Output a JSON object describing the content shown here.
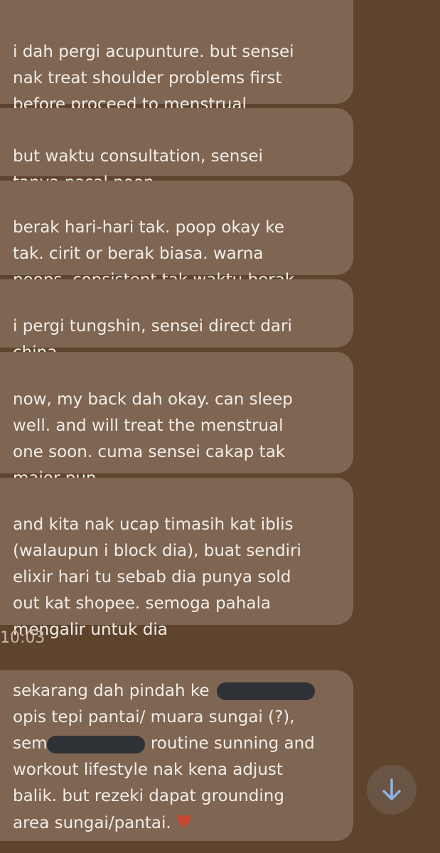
{
  "messages": [
    {
      "text": "i dah pergi acupunture. but sensei\nnak treat shoulder problems first\nbefore proceed to menstrual"
    },
    {
      "text": "but waktu consultation, sensei\ntanya pasal poop"
    },
    {
      "text": "berak hari-hari tak. poop okay ke\ntak. cirit or berak biasa. warna\npoops. consistent tak waktu berak"
    },
    {
      "text": "i pergi tungshin, sensei direct dari\nchina"
    },
    {
      "text": "now, my back dah okay. can sleep\nwell. and will treat the menstrual\none soon. cuma sensei cakap tak\nmajor pun"
    },
    {
      "text": "and kita nak ucap timasih kat iblis\n(walaupun i block dia), buat sendiri\nelixir hari tu sebab dia punya sold\nout kat shopee. semoga pahala\nmengalir untuk dia"
    }
  ],
  "timestamp": "10:03",
  "last_message": {
    "line1": "sekarang dah pindah ke",
    "line2": "opis tepi pantai/ muara sungai (?),",
    "line3a": "sem",
    "line3b": "routine sunning and",
    "line4": "workout lifestyle nak kena adjust",
    "line5": "balik. but rezeki dapat grounding",
    "line6": "area sungai/pantai.",
    "heart": "♥"
  },
  "icons": {
    "emoji": "face-with-tears-of-joy",
    "scroll": "arrow-down-icon"
  },
  "colors": {
    "background": "#5e442d",
    "bubble": "#7e6653",
    "text": "#f3ede7",
    "redaction": "#2e3136",
    "heart": "#c8462e",
    "scroll_arrow": "#8ab4e8"
  }
}
